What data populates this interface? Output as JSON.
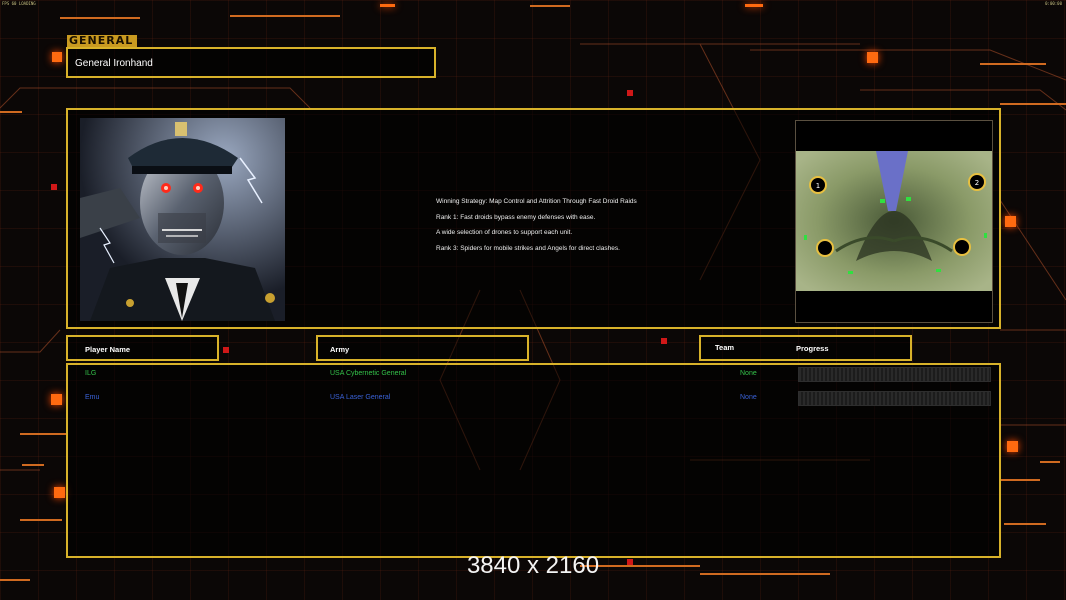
{
  "status_bar": {
    "left": "FPS 60 LOADING",
    "right": "0:00:00"
  },
  "general": {
    "section_label": "GENERAL",
    "name": "General Ironhand"
  },
  "strategy": {
    "lines": [
      "Winning Strategy: Map Control and Attrition Through Fast Droid Raids",
      "Rank 1: Fast droids bypass enemy defenses with ease.",
      "A wide selection of drones to support each unit.",
      "Rank 3: Spiders for mobile strikes and Angels for direct clashes."
    ]
  },
  "minimap": {
    "slots": [
      "1",
      "2",
      "",
      ""
    ]
  },
  "table": {
    "headers": {
      "player": "Player Name",
      "army": "Army",
      "team": "Team",
      "progress": "Progress"
    },
    "rows": [
      {
        "player": "ILG",
        "army": "USA Cybernetic General",
        "team": "None",
        "progress": 0,
        "color": "#34c24a"
      },
      {
        "player": "Emu",
        "army": "USA Laser General",
        "team": "None",
        "progress": 0,
        "color": "#3a62d8"
      }
    ]
  },
  "watermark": "3840 x 2160",
  "colors": {
    "gold": "#d8b22a",
    "accent_orange": "#ff6a10",
    "background": "#0b0706"
  }
}
